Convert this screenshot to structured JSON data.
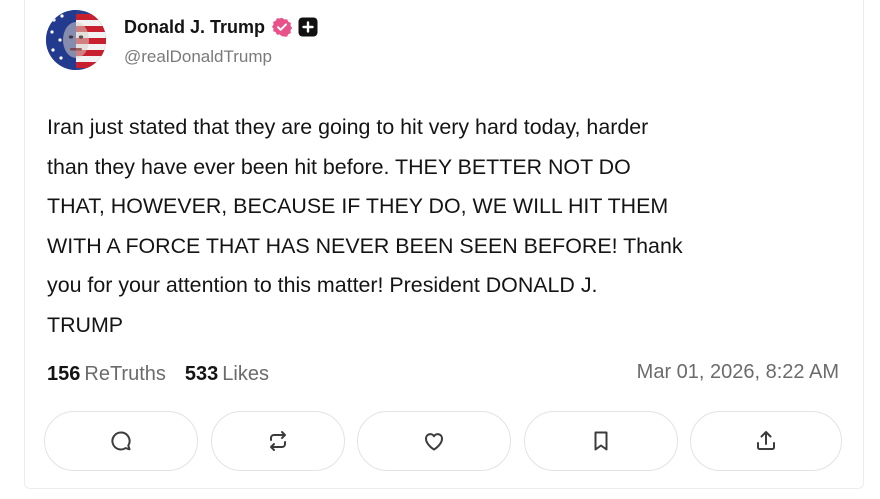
{
  "post": {
    "author": {
      "display_name": "Donald J. Trump",
      "handle": "@realDonaldTrump",
      "verified_icon": "verified-badge-icon",
      "extra_badge_icon": "plus-badge-icon",
      "verified_color": "#e8518a"
    },
    "text": "Iran just stated that they are going to hit very hard today, harder\nthan they have ever been hit before. THEY BETTER NOT DO\nTHAT, HOWEVER, BECAUSE IF THEY DO, WE WILL HIT THEM\nWITH A FORCE THAT HAS NEVER BEEN SEEN BEFORE! Thank\nyou for your attention to this matter! President DONALD J.\nTRUMP",
    "stats": {
      "retruths_count": "156",
      "retruths_label": "ReTruths",
      "likes_count": "533",
      "likes_label": "Likes"
    },
    "timestamp": "Mar 01, 2026, 8:22 AM"
  },
  "actions": [
    {
      "name": "reply",
      "icon": "comment-icon"
    },
    {
      "name": "retruth",
      "icon": "repost-icon"
    },
    {
      "name": "like",
      "icon": "heart-icon"
    },
    {
      "name": "bookmark",
      "icon": "bookmark-icon"
    },
    {
      "name": "share",
      "icon": "share-icon"
    }
  ],
  "colors": {
    "text": "#141414",
    "muted": "#6b6b6b",
    "border": "#e3e3e3",
    "icon": "#3c3c3c"
  }
}
